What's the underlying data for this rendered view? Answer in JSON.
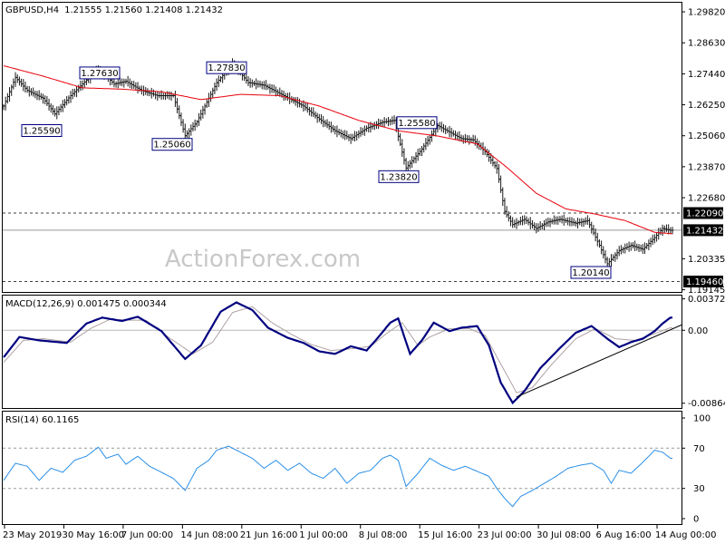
{
  "chart_data": {
    "type": "candlestick",
    "symbol": "GBPUSD,H4",
    "ohlc_label": "1.21555 1.21560 1.21408 1.21432",
    "watermark": "ActionForex.com",
    "price_panel": {
      "ylim": [
        1.1906,
        1.3017
      ],
      "y_ticks": [
        "1.29820",
        "1.28630",
        "1.27440",
        "1.26250",
        "1.25060",
        "1.23870",
        "1.22680",
        "1.20335",
        "1.19145"
      ],
      "last_price_label": "1.21432",
      "last_price": 1.21432,
      "horizontal_levels": [
        {
          "label": "1.22090",
          "value": 1.2209,
          "style": "dashed"
        },
        {
          "label": "1.19460",
          "value": 1.1946,
          "style": "dashed"
        }
      ],
      "annotations": [
        {
          "label": "1.27630",
          "value": 1.2763
        },
        {
          "label": "1.27830",
          "value": 1.2783
        },
        {
          "label": "1.25590",
          "value": 1.2559
        },
        {
          "label": "1.25060",
          "value": 1.2506
        },
        {
          "label": "1.25580",
          "value": 1.2558
        },
        {
          "label": "1.23820",
          "value": 1.2382
        },
        {
          "label": "1.20140",
          "value": 1.2014
        }
      ],
      "price_keypoints": [
        [
          0,
          1.262
        ],
        [
          6,
          1.273
        ],
        [
          12,
          1.268
        ],
        [
          20,
          1.265
        ],
        [
          26,
          1.259
        ],
        [
          34,
          1.266
        ],
        [
          42,
          1.272
        ],
        [
          48,
          1.2763
        ],
        [
          56,
          1.2705
        ],
        [
          62,
          1.2715
        ],
        [
          70,
          1.268
        ],
        [
          78,
          1.266
        ],
        [
          86,
          1.266
        ],
        [
          92,
          1.2506
        ],
        [
          98,
          1.256
        ],
        [
          108,
          1.271
        ],
        [
          116,
          1.2783
        ],
        [
          124,
          1.271
        ],
        [
          132,
          1.27
        ],
        [
          142,
          1.266
        ],
        [
          152,
          1.262
        ],
        [
          160,
          1.257
        ],
        [
          168,
          1.2525
        ],
        [
          176,
          1.2495
        ],
        [
          184,
          1.2535
        ],
        [
          192,
          1.2558
        ],
        [
          198,
          1.2565
        ],
        [
          204,
          1.2382
        ],
        [
          212,
          1.2455
        ],
        [
          220,
          1.2545
        ],
        [
          226,
          1.252
        ],
        [
          232,
          1.2495
        ],
        [
          238,
          1.249
        ],
        [
          244,
          1.2445
        ],
        [
          250,
          1.238
        ],
        [
          254,
          1.2215
        ],
        [
          258,
          1.2165
        ],
        [
          264,
          1.2185
        ],
        [
          270,
          1.215
        ],
        [
          276,
          1.2175
        ],
        [
          282,
          1.2185
        ],
        [
          290,
          1.217
        ],
        [
          296,
          1.218
        ],
        [
          302,
          1.2085
        ],
        [
          306,
          1.2014
        ],
        [
          312,
          1.2065
        ],
        [
          318,
          1.2085
        ],
        [
          324,
          1.207
        ],
        [
          330,
          1.2115
        ],
        [
          334,
          1.215
        ],
        [
          338,
          1.2143
        ]
      ],
      "ma_keypoints": [
        [
          0,
          1.2775
        ],
        [
          20,
          1.2735
        ],
        [
          40,
          1.269
        ],
        [
          60,
          1.2685
        ],
        [
          80,
          1.2675
        ],
        [
          100,
          1.2645
        ],
        [
          120,
          1.2665
        ],
        [
          140,
          1.266
        ],
        [
          160,
          1.262
        ],
        [
          180,
          1.2565
        ],
        [
          200,
          1.2525
        ],
        [
          220,
          1.2505
        ],
        [
          240,
          1.2475
        ],
        [
          255,
          1.2385
        ],
        [
          270,
          1.2285
        ],
        [
          285,
          1.2225
        ],
        [
          300,
          1.2205
        ],
        [
          315,
          1.218
        ],
        [
          330,
          1.2135
        ],
        [
          338,
          1.213
        ]
      ]
    },
    "macd_panel": {
      "title": "MACD(12,26,9) 0.001475 0.000344",
      "y_ticks": [
        "0.003722",
        "0.00",
        "-0.008643"
      ],
      "ylim": [
        -0.0091,
        0.004
      ],
      "macd_keypoints": [
        [
          0,
          -0.0032
        ],
        [
          8,
          -0.0008
        ],
        [
          18,
          -0.0012
        ],
        [
          32,
          -0.0015
        ],
        [
          42,
          0.0008
        ],
        [
          50,
          0.0015
        ],
        [
          60,
          0.0011
        ],
        [
          68,
          0.0016
        ],
        [
          80,
          -0.0001
        ],
        [
          92,
          -0.0034
        ],
        [
          100,
          -0.0018
        ],
        [
          110,
          0.0022
        ],
        [
          118,
          0.0033
        ],
        [
          126,
          0.0024
        ],
        [
          134,
          0.0003
        ],
        [
          144,
          -0.0009
        ],
        [
          152,
          -0.0015
        ],
        [
          160,
          -0.0025
        ],
        [
          168,
          -0.0028
        ],
        [
          176,
          -0.0019
        ],
        [
          184,
          -0.0024
        ],
        [
          190,
          -0.0008
        ],
        [
          196,
          0.0009
        ],
        [
          200,
          0.0014
        ],
        [
          206,
          -0.0028
        ],
        [
          212,
          -0.0012
        ],
        [
          218,
          0.0009
        ],
        [
          226,
          -0.0001
        ],
        [
          232,
          0.0003
        ],
        [
          240,
          0.0005
        ],
        [
          246,
          -0.0018
        ],
        [
          252,
          -0.0062
        ],
        [
          258,
          -0.0086
        ],
        [
          264,
          -0.0072
        ],
        [
          272,
          -0.0045
        ],
        [
          282,
          -0.0021
        ],
        [
          290,
          -0.0003
        ],
        [
          298,
          0.0005
        ],
        [
          306,
          -0.001
        ],
        [
          312,
          -0.002
        ],
        [
          318,
          -0.0014
        ],
        [
          324,
          -0.001
        ],
        [
          330,
          -0.0001
        ],
        [
          334,
          0.0008
        ],
        [
          338,
          0.0015
        ]
      ],
      "signal_keypoints": [
        [
          0,
          -0.0038
        ],
        [
          10,
          -0.0012
        ],
        [
          20,
          -0.001
        ],
        [
          34,
          -0.0014
        ],
        [
          44,
          0.0002
        ],
        [
          54,
          0.0013
        ],
        [
          64,
          0.0012
        ],
        [
          72,
          0.0012
        ],
        [
          84,
          -0.0009
        ],
        [
          96,
          -0.0028
        ],
        [
          106,
          -0.0014
        ],
        [
          116,
          0.0021
        ],
        [
          126,
          0.0028
        ],
        [
          136,
          0.0009
        ],
        [
          146,
          -0.0005
        ],
        [
          156,
          -0.0017
        ],
        [
          166,
          -0.0024
        ],
        [
          176,
          -0.0022
        ],
        [
          186,
          -0.0019
        ],
        [
          194,
          -0.0004
        ],
        [
          202,
          0.0009
        ],
        [
          210,
          -0.0018
        ],
        [
          216,
          -0.0008
        ],
        [
          226,
          0.0002
        ],
        [
          236,
          0.0002
        ],
        [
          244,
          -0.0006
        ],
        [
          252,
          -0.004
        ],
        [
          260,
          -0.0074
        ],
        [
          268,
          -0.0068
        ],
        [
          278,
          -0.004
        ],
        [
          290,
          -0.001
        ],
        [
          300,
          0.0002
        ],
        [
          310,
          -0.001
        ],
        [
          320,
          -0.0012
        ],
        [
          330,
          -0.0004
        ],
        [
          338,
          0.0003
        ]
      ],
      "trendline": {
        "from": [
          260,
          -0.0079
        ],
        "to": [
          338,
          0.0002
        ]
      }
    },
    "rsi_panel": {
      "title": "RSI(14) 60.1165",
      "y_ticks": [
        "100",
        "70",
        "30",
        "0"
      ],
      "ylim": [
        0,
        100
      ],
      "levels": [
        70,
        30
      ],
      "rsi_keypoints": [
        [
          0,
          38
        ],
        [
          6,
          55
        ],
        [
          12,
          52
        ],
        [
          18,
          38
        ],
        [
          24,
          50
        ],
        [
          30,
          46
        ],
        [
          36,
          58
        ],
        [
          42,
          62
        ],
        [
          48,
          71
        ],
        [
          52,
          60
        ],
        [
          58,
          64
        ],
        [
          62,
          54
        ],
        [
          68,
          62
        ],
        [
          74,
          52
        ],
        [
          80,
          46
        ],
        [
          86,
          40
        ],
        [
          92,
          28
        ],
        [
          98,
          50
        ],
        [
          104,
          58
        ],
        [
          108,
          68
        ],
        [
          114,
          72
        ],
        [
          120,
          66
        ],
        [
          126,
          60
        ],
        [
          132,
          50
        ],
        [
          138,
          58
        ],
        [
          144,
          48
        ],
        [
          150,
          55
        ],
        [
          156,
          45
        ],
        [
          162,
          40
        ],
        [
          168,
          50
        ],
        [
          174,
          35
        ],
        [
          180,
          45
        ],
        [
          186,
          48
        ],
        [
          192,
          60
        ],
        [
          196,
          63
        ],
        [
          200,
          58
        ],
        [
          204,
          32
        ],
        [
          210,
          45
        ],
        [
          216,
          60
        ],
        [
          222,
          53
        ],
        [
          228,
          48
        ],
        [
          234,
          52
        ],
        [
          240,
          47
        ],
        [
          246,
          42
        ],
        [
          250,
          30
        ],
        [
          254,
          20
        ],
        [
          258,
          12
        ],
        [
          262,
          22
        ],
        [
          268,
          28
        ],
        [
          274,
          35
        ],
        [
          280,
          42
        ],
        [
          286,
          50
        ],
        [
          292,
          53
        ],
        [
          298,
          55
        ],
        [
          304,
          48
        ],
        [
          308,
          35
        ],
        [
          312,
          48
        ],
        [
          318,
          45
        ],
        [
          324,
          56
        ],
        [
          330,
          68
        ],
        [
          334,
          66
        ],
        [
          338,
          60
        ]
      ]
    },
    "x_axis_labels": [
      "23 May 2019",
      "30 May 16:00",
      "7 Jun 00:00",
      "14 Jun 08:00",
      "21 Jun 16:00",
      "1 Jul 00:00",
      "8 Jul 08:00",
      "15 Jul 16:00",
      "23 Jul 00:00",
      "30 Jul 08:00",
      "6 Aug 16:00",
      "14 Aug 00:00"
    ],
    "colors": {
      "candles": "#1a1a1a",
      "ma": "#e8000b",
      "macd": "#000080",
      "signal": "#b0a2a4",
      "rsi": "#2a8fe8",
      "label_border": "#000080",
      "grid_dashed": "#404040"
    }
  }
}
